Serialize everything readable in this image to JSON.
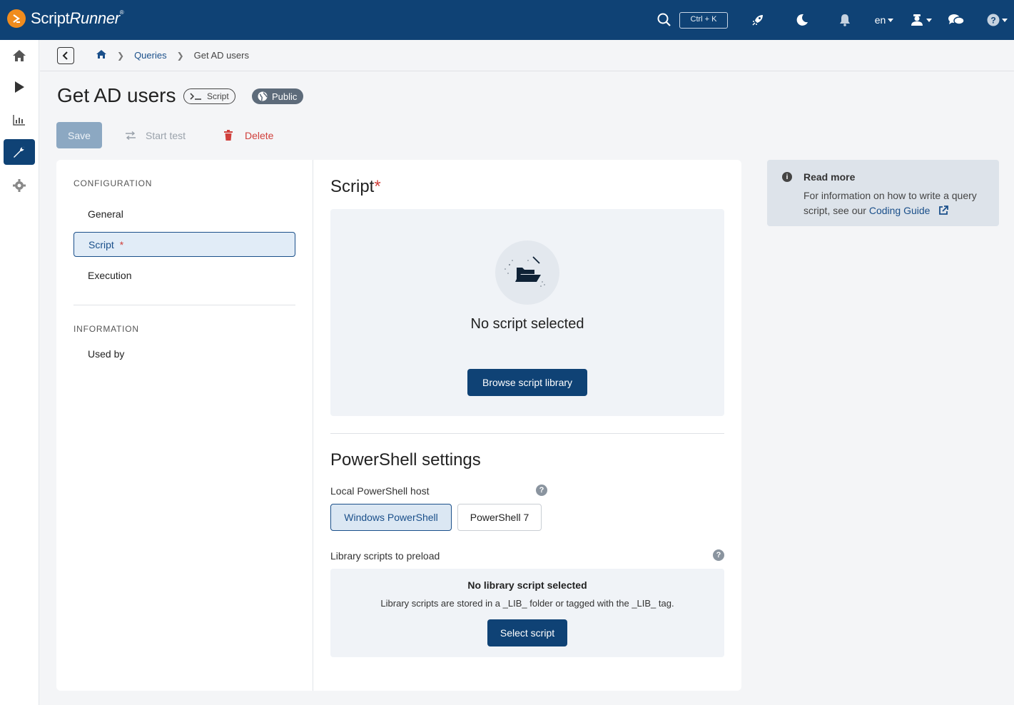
{
  "app": {
    "brand_main": "Script",
    "brand_italic": "Runner",
    "brand_mark": "®"
  },
  "topbar": {
    "shortcut": "Ctrl + K",
    "language": "en"
  },
  "breadcrumb": {
    "items": [
      "Queries",
      "Get AD users"
    ]
  },
  "page": {
    "title": "Get AD users",
    "type_chip": "Script",
    "visibility_chip": "Public"
  },
  "actions": {
    "save": "Save",
    "start_test": "Start test",
    "delete": "Delete"
  },
  "sidenav": {
    "configuration_heading": "CONFIGURATION",
    "items": [
      "General",
      "Script",
      "Execution"
    ],
    "required_mark": "*",
    "information_heading": "INFORMATION",
    "info_items": [
      "Used by"
    ]
  },
  "script_section": {
    "heading": "Script",
    "required_mark": "*",
    "empty_title": "No script selected",
    "browse_button": "Browse script library"
  },
  "powershell": {
    "heading": "PowerShell settings",
    "host_label": "Local PowerShell host",
    "host_options": [
      "Windows PowerShell",
      "PowerShell 7"
    ],
    "selected_host": "Windows PowerShell",
    "preload_label": "Library scripts to preload",
    "no_lib_title": "No library script selected",
    "no_lib_desc": "Library scripts are stored in a _LIB_ folder or tagged with the _LIB_ tag.",
    "select_button": "Select script"
  },
  "read_more": {
    "title": "Read more",
    "text": "For information on how to write a query script, see our",
    "link": "Coding Guide"
  },
  "colors": {
    "primary": "#0f4275",
    "accent": "#f08c1e",
    "danger": "#d0403c"
  }
}
